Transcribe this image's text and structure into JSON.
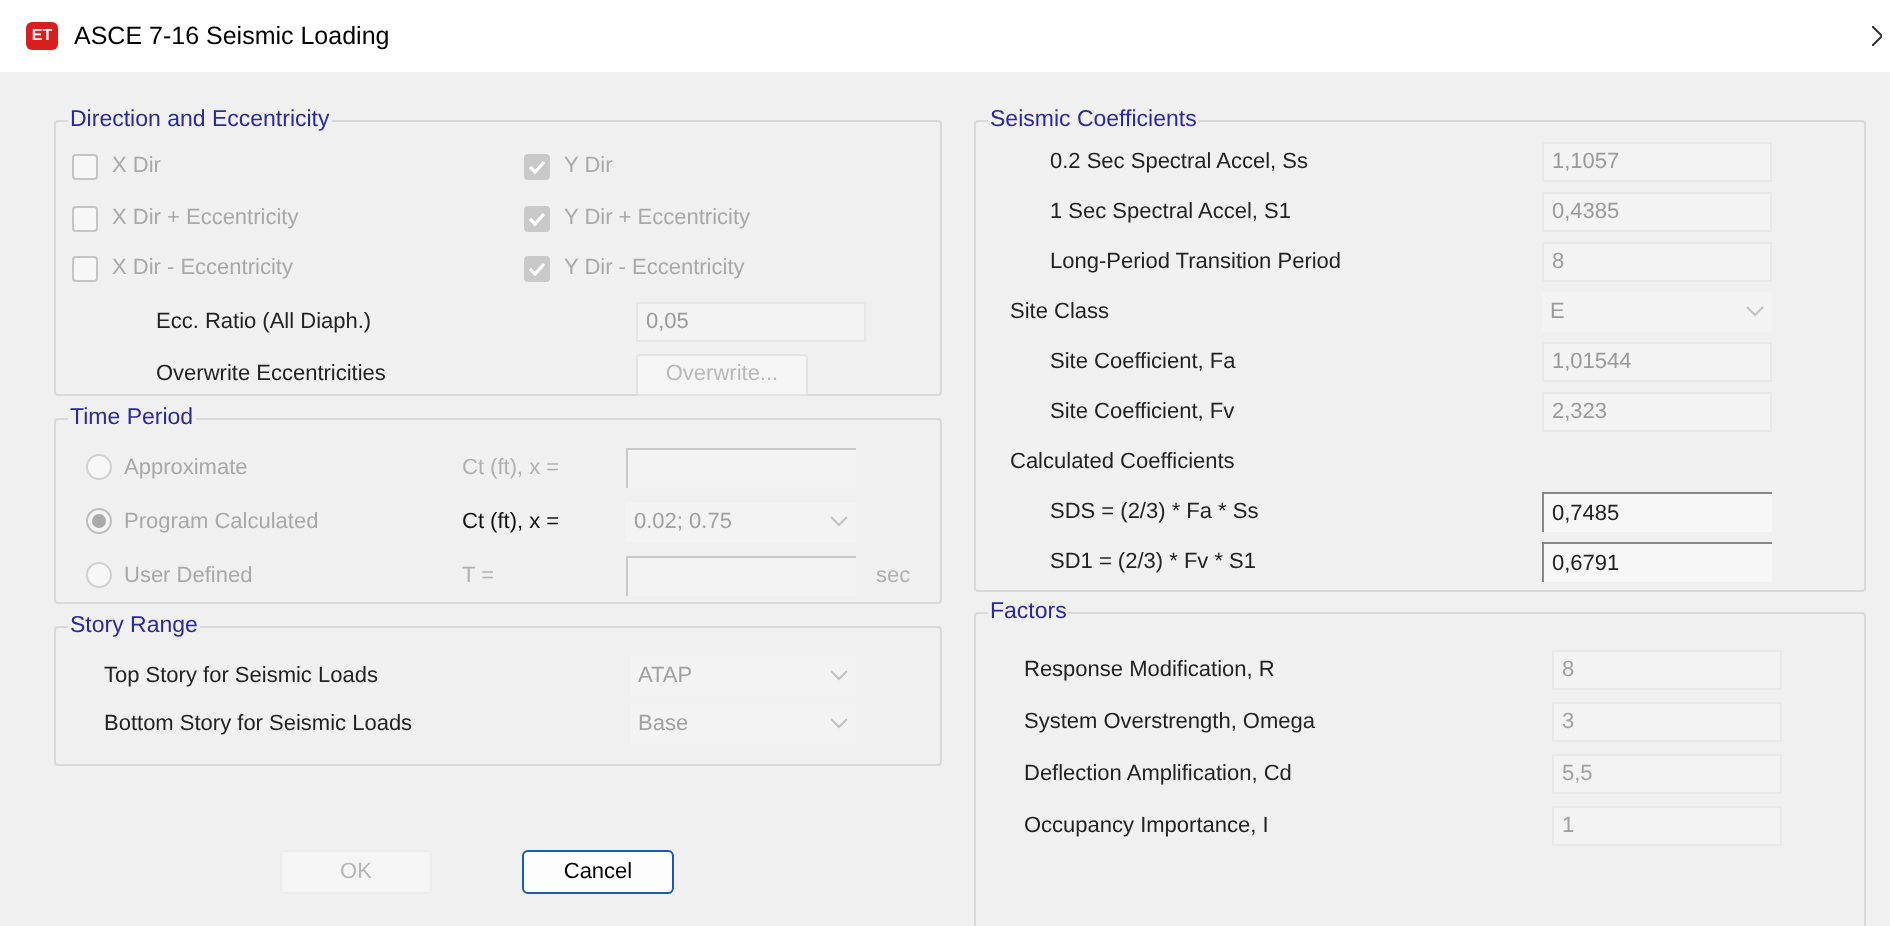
{
  "window": {
    "title": "ASCE 7-16 Seismic Loading",
    "app_icon": "ET"
  },
  "direction_and_eccentricity": {
    "title": "Direction and Eccentricity",
    "checkboxes": [
      {
        "label": "X Dir",
        "checked": false,
        "disabled": true
      },
      {
        "label": "Y Dir",
        "checked": true,
        "disabled": true
      },
      {
        "label": "X Dir + Eccentricity",
        "checked": false,
        "disabled": true
      },
      {
        "label": "Y Dir + Eccentricity",
        "checked": true,
        "disabled": true
      },
      {
        "label": "X Dir - Eccentricity",
        "checked": false,
        "disabled": true
      },
      {
        "label": "Y Dir - Eccentricity",
        "checked": true,
        "disabled": true
      }
    ],
    "ecc_ratio": {
      "label": "Ecc. Ratio (All Diaph.)",
      "value": "0,05"
    },
    "overwrite": {
      "label": "Overwrite Eccentricities",
      "button": "Overwrite...",
      "disabled": true
    }
  },
  "time_period": {
    "title": "Time Period",
    "options": [
      {
        "label": "Approximate",
        "selected": false,
        "field_label": "Ct (ft), x =",
        "kind": "field"
      },
      {
        "label": "Program Calculated",
        "selected": true,
        "field_label": "Ct (ft), x =",
        "kind": "dropdown",
        "value": "0.02;  0.75"
      },
      {
        "label": "User Defined",
        "selected": false,
        "field_label": "T =",
        "kind": "field",
        "unit": "sec"
      }
    ]
  },
  "story_range": {
    "title": "Story Range",
    "rows": [
      {
        "label": "Top Story for Seismic Loads",
        "value": "ATAP"
      },
      {
        "label": "Bottom Story for Seismic Loads",
        "value": "Base"
      }
    ]
  },
  "buttons": [
    {
      "label": "OK",
      "disabled": true
    },
    {
      "label": "Cancel",
      "disabled": false
    }
  ],
  "seismic_coefficients": {
    "title": "Seismic Coefficients",
    "rows": [
      {
        "kind": "input",
        "label": "0.2 Sec Spectral Accel, Ss",
        "value": "1,1057"
      },
      {
        "kind": "input",
        "label": "1 Sec Spectral Accel, S1",
        "value": "0,4385"
      },
      {
        "kind": "input",
        "label": "Long-Period Transition Period",
        "value": "8"
      },
      {
        "kind": "select",
        "label": "Site Class",
        "value": "E"
      },
      {
        "kind": "input",
        "label": "Site Coefficient, Fa",
        "value": "1,01544"
      },
      {
        "kind": "input",
        "label": "Site Coefficient, Fv",
        "value": "2,323"
      },
      {
        "kind": "heading",
        "label": "Calculated Coefficients"
      },
      {
        "kind": "result",
        "label": "SDS = (2/3) * Fa * Ss",
        "value": "0,7485"
      },
      {
        "kind": "result",
        "label": "SD1 = (2/3) * Fv * S1",
        "value": "0,6791"
      }
    ]
  },
  "factors": {
    "title": "Factors",
    "rows": [
      {
        "label": "Response Modification, R",
        "value": "8"
      },
      {
        "label": "System Overstrength, Omega",
        "value": "3"
      },
      {
        "label": "Deflection Amplification, Cd",
        "value": "5,5"
      },
      {
        "label": "Occupancy Importance, I",
        "value": "1"
      }
    ]
  }
}
